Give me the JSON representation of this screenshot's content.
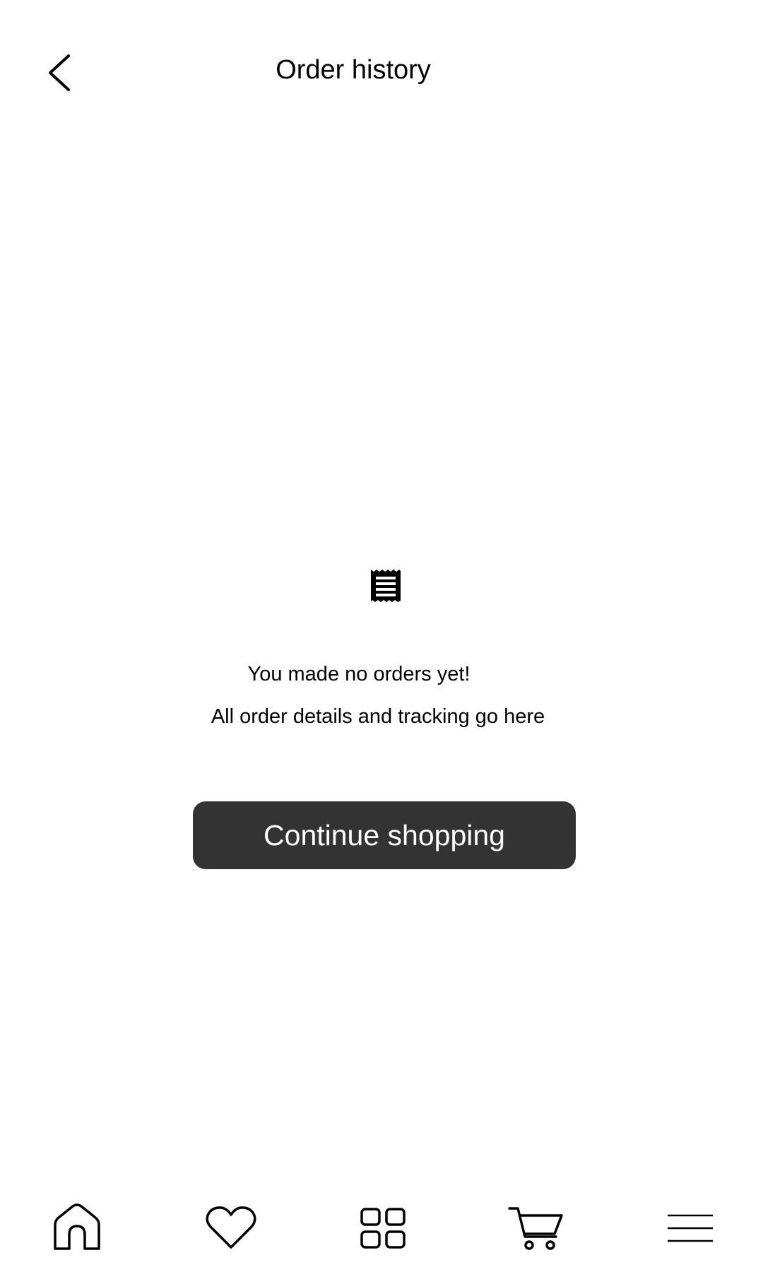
{
  "header": {
    "title": "Order history",
    "back_icon": "chevron-left-icon"
  },
  "empty_state": {
    "icon": "receipt-icon",
    "title": "You made no orders yet!",
    "subtitle": "All order details and tracking go here",
    "button_label": "Continue shopping",
    "button_color": "#333333"
  },
  "bottom_nav": {
    "items": [
      {
        "icon": "home-icon"
      },
      {
        "icon": "heart-icon"
      },
      {
        "icon": "grid-icon"
      },
      {
        "icon": "cart-icon"
      },
      {
        "icon": "menu-icon"
      }
    ]
  }
}
